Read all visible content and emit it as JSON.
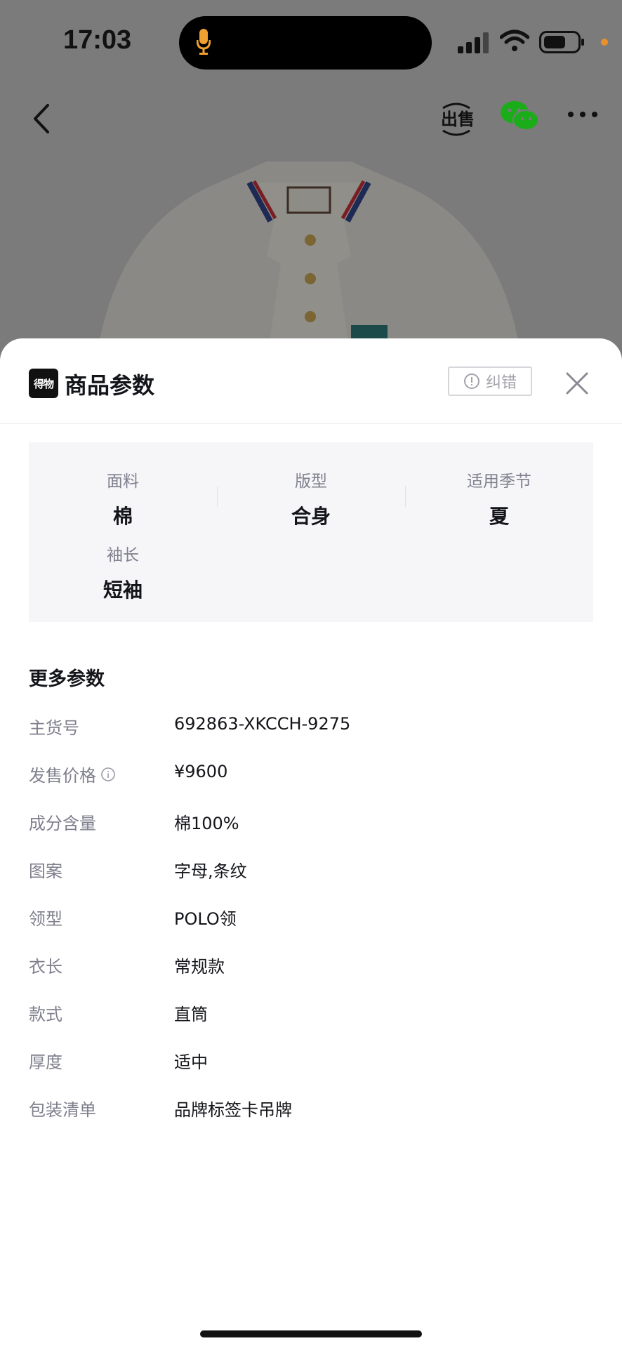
{
  "status_bar": {
    "time": "17:03"
  },
  "nav": {
    "back_icon": "chevron-left-icon",
    "sell_icon": "sell-icon",
    "share_icon": "wechat-icon",
    "more_icon": "more-horizontal-icon"
  },
  "sheet": {
    "brand_logo": "得物",
    "title": "商品参数",
    "report_label": "纠错",
    "close_icon": "close-icon"
  },
  "attributes": [
    {
      "label": "面料",
      "value": "棉"
    },
    {
      "label": "版型",
      "value": "合身"
    },
    {
      "label": "适用季节",
      "value": "夏"
    },
    {
      "label": "袖长",
      "value": "短袖"
    }
  ],
  "more_params": {
    "title": "更多参数",
    "rows": [
      {
        "label": "主货号",
        "value": "692863-XKCCH-9275"
      },
      {
        "label": "发售价格",
        "value": "¥9600",
        "info_icon": true
      },
      {
        "label": "成分含量",
        "value": "棉100%"
      },
      {
        "label": "图案",
        "value": "字母,条纹"
      },
      {
        "label": "领型",
        "value": "POLO领"
      },
      {
        "label": "衣长",
        "value": "常规款"
      },
      {
        "label": "款式",
        "value": "直筒"
      },
      {
        "label": "厚度",
        "value": "适中"
      },
      {
        "label": "包装清单",
        "value": "品牌标签卡吊牌"
      }
    ]
  },
  "colors": {
    "overlay": "#7b7b7b",
    "sheet_bg": "#ffffff",
    "attr_box_bg": "#f6f6f9",
    "label_gray": "#7f7f8e",
    "text_dark": "#14151a",
    "wechat_green": "#1aad19",
    "mic_orange": "#f0a030"
  }
}
